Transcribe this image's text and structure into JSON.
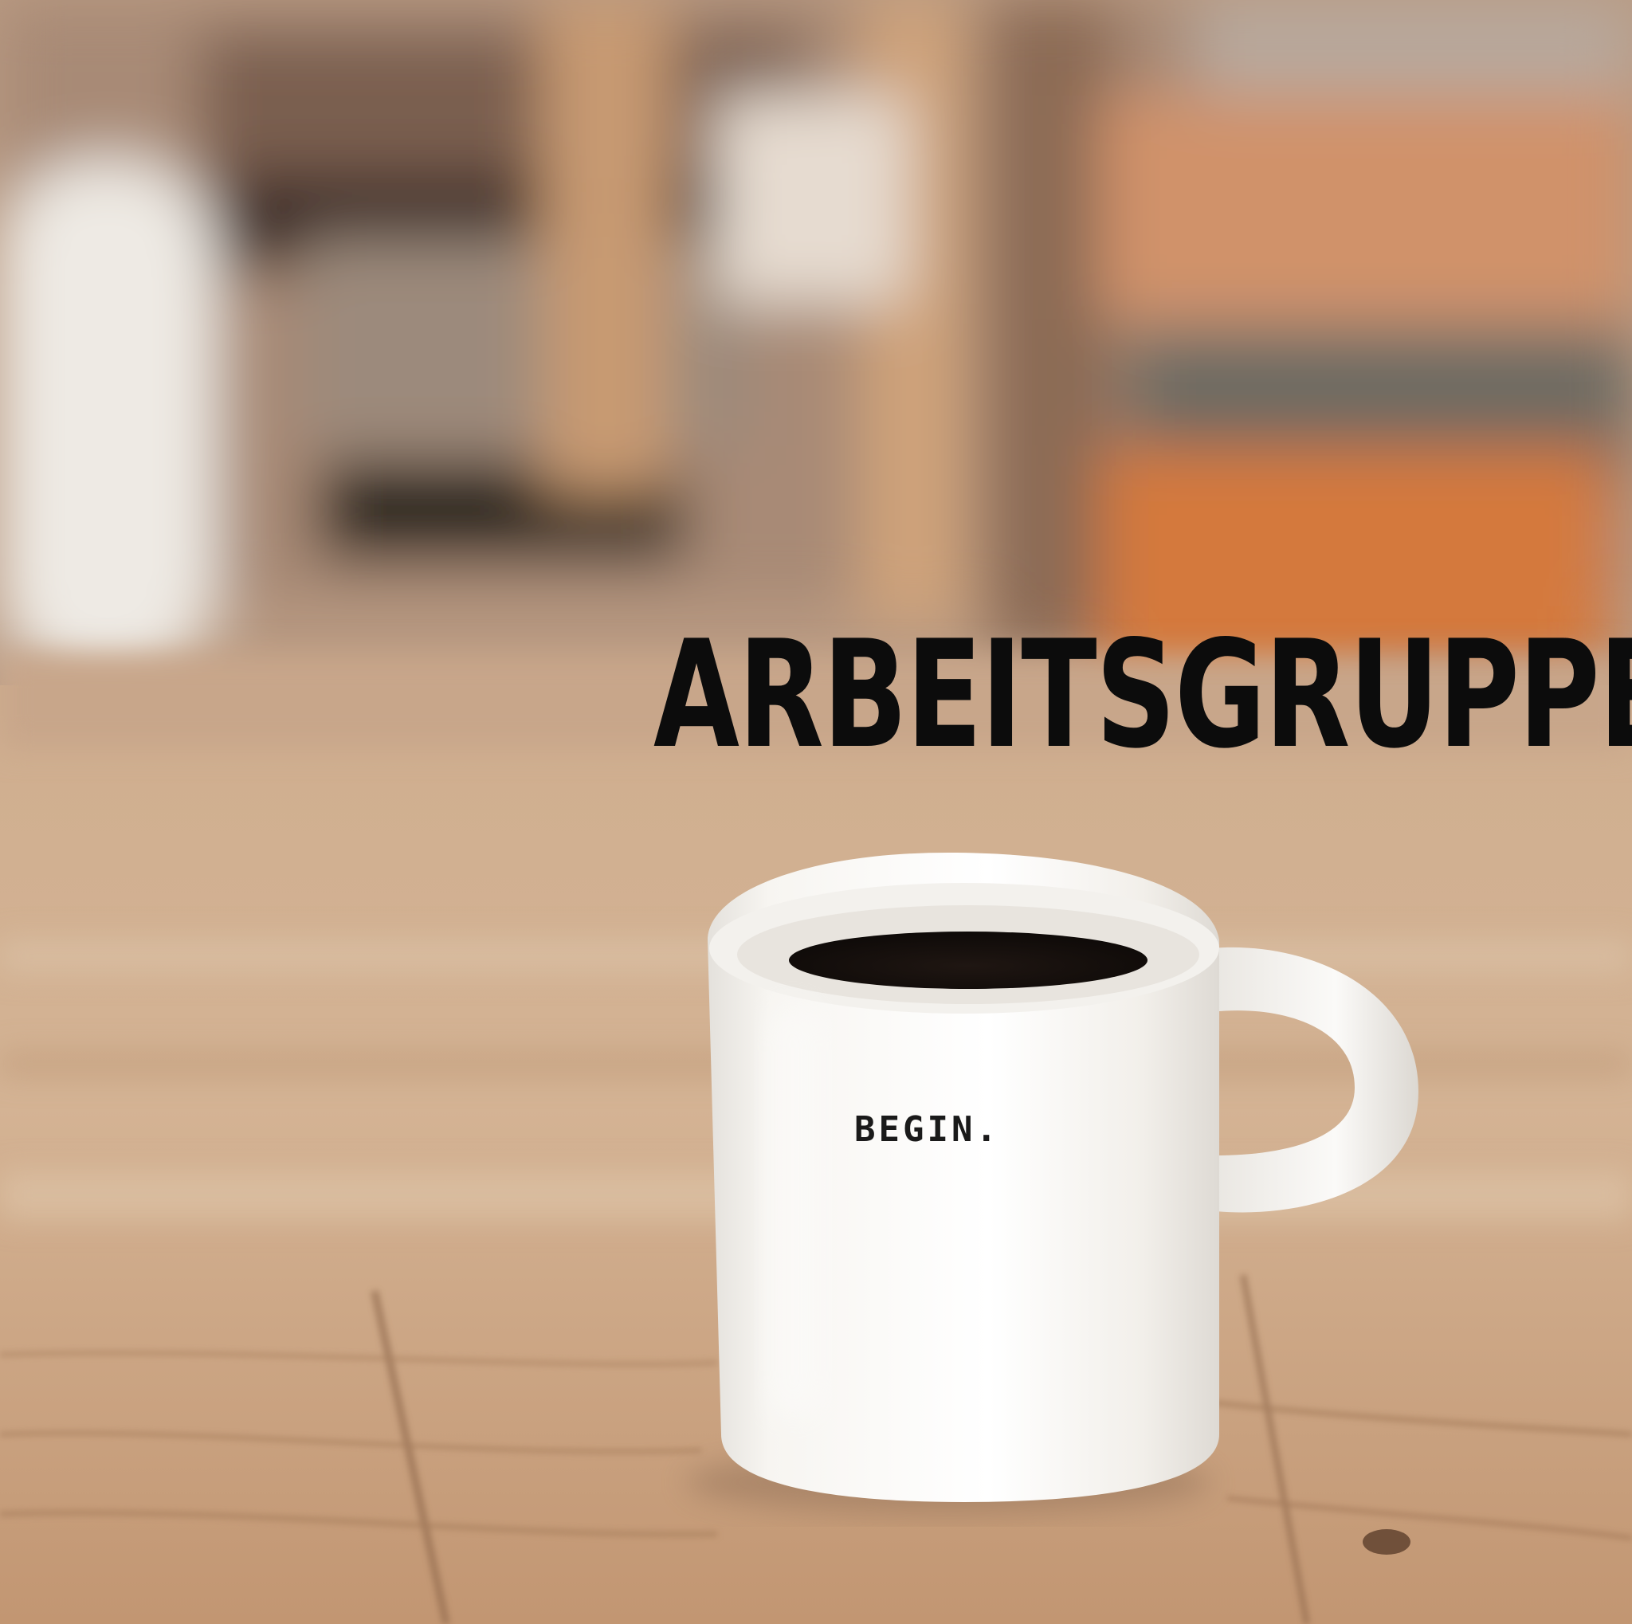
{
  "headline": "ARBEITSGRUPPEN",
  "mug": {
    "text": "BEGIN."
  },
  "palette": {
    "headline_color": "#0c0c0c",
    "wood_light": "#d8bb9c",
    "wood_mid": "#c49a74",
    "wood_dark": "#8a6446",
    "mug_white": "#f6f4f0",
    "coffee": "#1c1410",
    "orange_chair": "#d5773a"
  }
}
